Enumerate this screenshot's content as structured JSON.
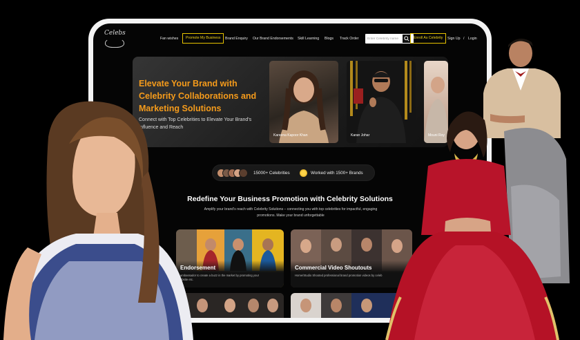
{
  "nav": {
    "logo_text": "Celebs",
    "fan_wishes": "Fan wishes",
    "promote": "Promote My Business",
    "brand_enquiry": "Brand Enquiry",
    "brand_endorsements": "Our Brand Endorsements",
    "skill_learning": "Skill Learning",
    "blogs": "Blogs",
    "track_order": "Track Order",
    "search_placeholder": "Enter Celebrity name",
    "enroll": "Enroll As Celebrity",
    "sign_up": "Sign Up",
    "separator": "/",
    "login": "Login"
  },
  "hero": {
    "title": "Elevate Your Brand with Celebrity Collaborations and Marketing Solutions",
    "subtitle": "Connect with Top Celebrities to Elevate Your Brand's Influence and Reach",
    "celebrities": [
      {
        "name": "Kareena Kapoor Khan"
      },
      {
        "name": "Karan Johar"
      },
      {
        "name": "Mouni Roy"
      }
    ]
  },
  "stats": {
    "celebrities": "15000+ Celebrities",
    "brands": "Worked with 1500+ Brands"
  },
  "section": {
    "title": "Redefine Your Business Promotion with Celebrity Solutions",
    "subtitle": "Amplify your brand's reach with Celebrity Solutions – connecting you with top celebrities for impactful, engaging promotions. Make your brand unforgettable"
  },
  "services": [
    {
      "title": "Endorsement",
      "desc": "ambassador to create a buzz in the market by promoting your",
      "desc2": "ebsite etc."
    },
    {
      "title": "Commercial Video Shoutouts",
      "desc": "Home/Studio Shooted professional brand promotion videos by celeb"
    }
  ],
  "colors": {
    "accent_orange": "#f59b1b",
    "accent_yellow": "#f2d31b",
    "background": "#050505"
  }
}
